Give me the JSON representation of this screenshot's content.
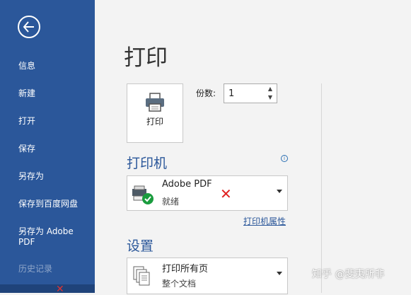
{
  "sidebar": {
    "items": [
      {
        "label": "信息"
      },
      {
        "label": "新建"
      },
      {
        "label": "打开"
      },
      {
        "label": "保存"
      },
      {
        "label": "另存为"
      },
      {
        "label": "保存到百度网盘"
      },
      {
        "label": "另存为 Adobe PDF"
      },
      {
        "label": "历史记录"
      }
    ]
  },
  "main": {
    "title": "打印",
    "print_button_label": "打印",
    "copies_label": "份数:",
    "copies_value": "1",
    "printer_section": "打印机",
    "printer": {
      "name": "Adobe PDF",
      "status": "就绪"
    },
    "printer_properties": "打印机属性",
    "settings_section": "设置",
    "pages_setting": {
      "title": "打印所有页",
      "sub": "整个文档"
    }
  },
  "watermark": "知乎 @斐夷所非",
  "colors": {
    "accent": "#2b579a",
    "background": "#f3f3f3",
    "error": "#e02020"
  }
}
